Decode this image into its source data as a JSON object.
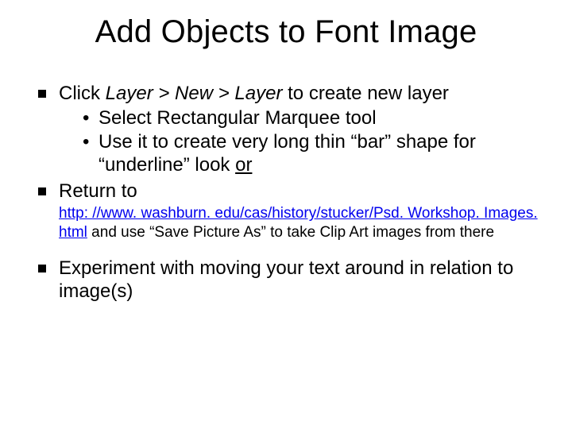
{
  "title": "Add Objects to Font Image",
  "bullets": {
    "b1": {
      "pre": "Click ",
      "em": "Layer > New > Layer",
      "post": " to create new layer"
    },
    "b1_sub1": "Select Rectangular Marquee tool",
    "b1_sub2": "Use it to create very long thin “bar” shape for “underline” look ",
    "b1_sub2_or": "or",
    "b2": "Return to",
    "b2_link": "http: //www. washburn. edu/cas/history/stucker/Psd. Workshop. Images. html",
    "b2_tail": " and use “Save Picture As” to take Clip Art images from there",
    "b3": "Experiment with moving your text around in relation to image(s)"
  }
}
